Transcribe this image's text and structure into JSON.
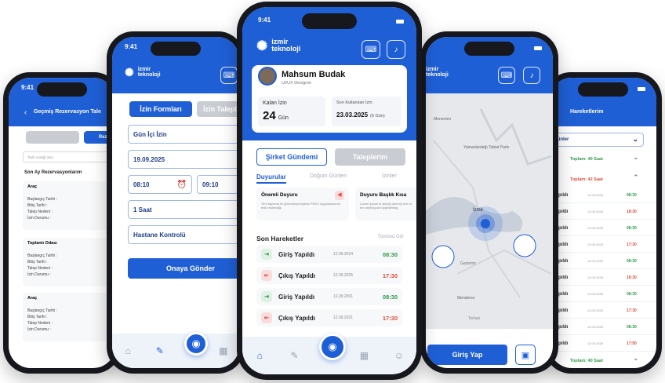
{
  "brand": {
    "name_line1": "izmir",
    "name_line2": "teknoloji",
    "primary": "#1f5fd6",
    "green": "#2e9b4a",
    "red": "#e04a3a"
  },
  "phone1": {
    "title": "Geçmiş Rezervasyon Tale",
    "tab_left": "",
    "tab_right": "Rez.",
    "search_placeholder": "Tarih Aralığı Seç",
    "section": "Son Ay Rezervasyonlarım",
    "cards": [
      {
        "title": "Araç",
        "rows": [
          "Başlangıç Tarihi :",
          "Bitiş Tarihi :",
          "Talep Nedeni :",
          "İzin Durumu :"
        ]
      },
      {
        "title": "Toplantı Odası",
        "rows": [
          "Başlangıç Tarihi :",
          "Bitiş Tarihi :",
          "Talep Nedeni :",
          "İzin Durumu :"
        ]
      },
      {
        "title": "Araç",
        "rows": [
          "Başlangıç Tarihi :",
          "Bitiş Tarihi :",
          "Talep Nedeni :",
          "İzin Durumu :"
        ]
      }
    ],
    "status_time": "9:41"
  },
  "phone2": {
    "status_time": "9:41",
    "tab_active": "İzin Formları",
    "tab_inactive": "İzin Talepleri",
    "field_type": "Gün İçi İzin",
    "field_date": "19.09.2025",
    "field_start": "08:10",
    "field_end": "09:10",
    "field_duration": "1 Saat",
    "field_reason": "Hastane Kontrolü",
    "submit": "Onaya Gönder"
  },
  "phone3": {
    "status_time": "9:41",
    "user_name": "Mahsum Budak",
    "user_role": "UI/UX Designer",
    "leave_label": "Kalan İzin",
    "leave_value": "24",
    "leave_unit": "Gün",
    "last_label": "Son Kullanılan İzin",
    "last_date": "23.03.2025",
    "last_extra": "(6 Gün)",
    "btn_agenda": "Şirket Gündemi",
    "btn_requests": "Taleplerim",
    "tabs": [
      "Duyurular",
      "Doğum Günleri",
      "İzinler"
    ],
    "ann1_title": "Önemli Duyuru",
    "ann1_body": "Yeni taşınma ile güncelleyeceğimiz PDKS uygulamasının testi reklendiği.",
    "ann2_title": "Duyuru Başlık Kısa",
    "ann2_body": "Lorem ipsum is simply dummy text of the printing and typesetting.",
    "recent_title": "Son Hareketler",
    "recent_link": "Tümünü Gör",
    "activity": [
      {
        "label": "Giriş Yapıldı",
        "date": "12.09.2024",
        "time": "08:30",
        "kind": "in"
      },
      {
        "label": "Çıkış Yapıldı",
        "date": "12.09.2025",
        "time": "17:30",
        "kind": "out"
      },
      {
        "label": "Giriş Yapıldı",
        "date": "12.09.2001",
        "time": "08:30",
        "kind": "in"
      },
      {
        "label": "Çıkış Yapıldı",
        "date": "12.09.2021",
        "time": "17:30",
        "kind": "out"
      }
    ]
  },
  "phone4": {
    "status_time": "9:41",
    "map_labels": [
      "Menemen",
      "Yamanlardağı Tabiat Parkı",
      "İzmir",
      "Gaziemir",
      "Menderes",
      "Torbalı"
    ],
    "checkin": "Giriş Yap"
  },
  "phone5": {
    "title": "Hareketlerim",
    "filter": "Günler",
    "total_green": "Toplam: 40 Saat",
    "total_red": "Toplam: 42 Saat",
    "rows": [
      {
        "label": "Yapıldı",
        "date": "12.09.2025",
        "time": "08:30",
        "kind": "in"
      },
      {
        "label": "Yapıldı",
        "date": "12.09.2025",
        "time": "18:30",
        "kind": "out"
      },
      {
        "label": "Yapıldı",
        "date": "12.09.2025",
        "time": "08:30",
        "kind": "in"
      },
      {
        "label": "Yapıldı",
        "date": "12.09.2025",
        "time": "17:30",
        "kind": "out"
      },
      {
        "label": "Yapıldı",
        "date": "12.09.2025",
        "time": "08:30",
        "kind": "in"
      },
      {
        "label": "Yapıldı",
        "date": "12.09.2025",
        "time": "18:30",
        "kind": "out"
      },
      {
        "label": "Yapıldı",
        "date": "12.09.2025",
        "time": "08:30",
        "kind": "in"
      },
      {
        "label": "Yapıldı",
        "date": "12.09.2025",
        "time": "17:30",
        "kind": "out"
      },
      {
        "label": "Yapıldı",
        "date": "12.09.2025",
        "time": "08:30",
        "kind": "in"
      },
      {
        "label": "Yapıldı",
        "date": "12.09.2025",
        "time": "17:50",
        "kind": "out"
      }
    ],
    "total_bottom": "Toplam: 40 Saat",
    "status_time": "9:41"
  }
}
